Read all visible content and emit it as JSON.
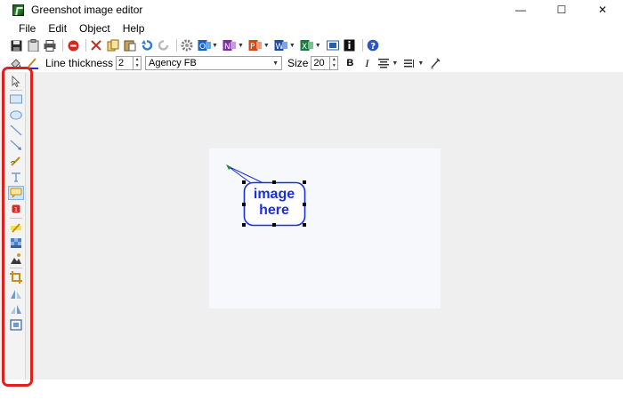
{
  "window": {
    "title": "Greenshot image editor",
    "controls": {
      "minimize": "—",
      "maximize": "☐",
      "close": "✕"
    }
  },
  "menu": {
    "items": [
      "File",
      "Edit",
      "Object",
      "Help"
    ]
  },
  "toolbar2": {
    "line_thickness_label": "Line thickness",
    "line_thickness_value": "2",
    "font_value": "Agency FB",
    "size_label": "Size",
    "size_value": "20",
    "bold_label": "B",
    "italic_label": "I"
  },
  "canvas": {
    "speech_bubble_text_line1": "image",
    "speech_bubble_text_line2": "here",
    "text_color": "#1a2fe0"
  },
  "colors": {
    "highlight": "#e0201d",
    "canvas_bg": "#efefef"
  }
}
